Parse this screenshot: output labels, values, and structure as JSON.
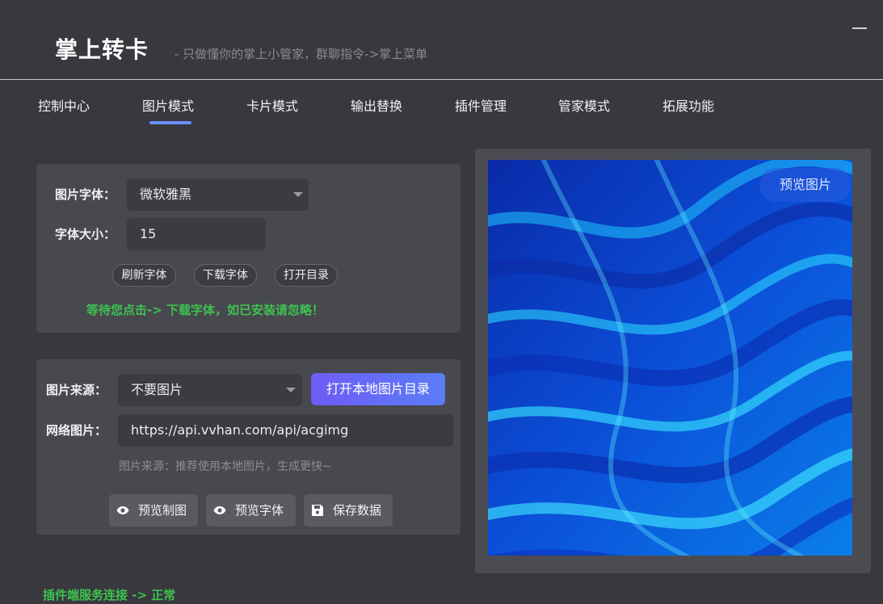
{
  "header": {
    "title": "掌上转卡",
    "subtitle": "- 只做懂你的掌上小管家，群聊指令->掌上菜单"
  },
  "tabs": [
    {
      "label": "控制中心"
    },
    {
      "label": "图片模式",
      "active": true
    },
    {
      "label": "卡片模式"
    },
    {
      "label": "输出替换"
    },
    {
      "label": "插件管理"
    },
    {
      "label": "管家模式"
    },
    {
      "label": "拓展功能"
    }
  ],
  "font_panel": {
    "font_label": "图片字体：",
    "font_value": "微软雅黑",
    "size_label": "字体大小：",
    "size_value": "15",
    "refresh_button": "刷新字体",
    "download_button": "下载字体",
    "open_dir_button": "打开目录",
    "hint": "等待您点击-> 下载字体，如已安装请忽略！"
  },
  "image_panel": {
    "source_label": "图片来源：",
    "source_value": "不要图片",
    "open_local_button": "打开本地图片目录",
    "network_label": "网络图片：",
    "network_value": "https://api.vvhan.com/api/acgimg",
    "hint": "图片来源：推荐使用本地图片，生成更快~",
    "preview_draw_button": "预览制图",
    "preview_font_button": "预览字体",
    "save_button": "保存数据"
  },
  "preview": {
    "badge": "预览图片"
  },
  "status": "插件端服务连接 -> 正常",
  "colors": {
    "accent": "#6a8cff",
    "success": "#3ec24f",
    "background": "#38383e",
    "panel": "#48484f"
  }
}
